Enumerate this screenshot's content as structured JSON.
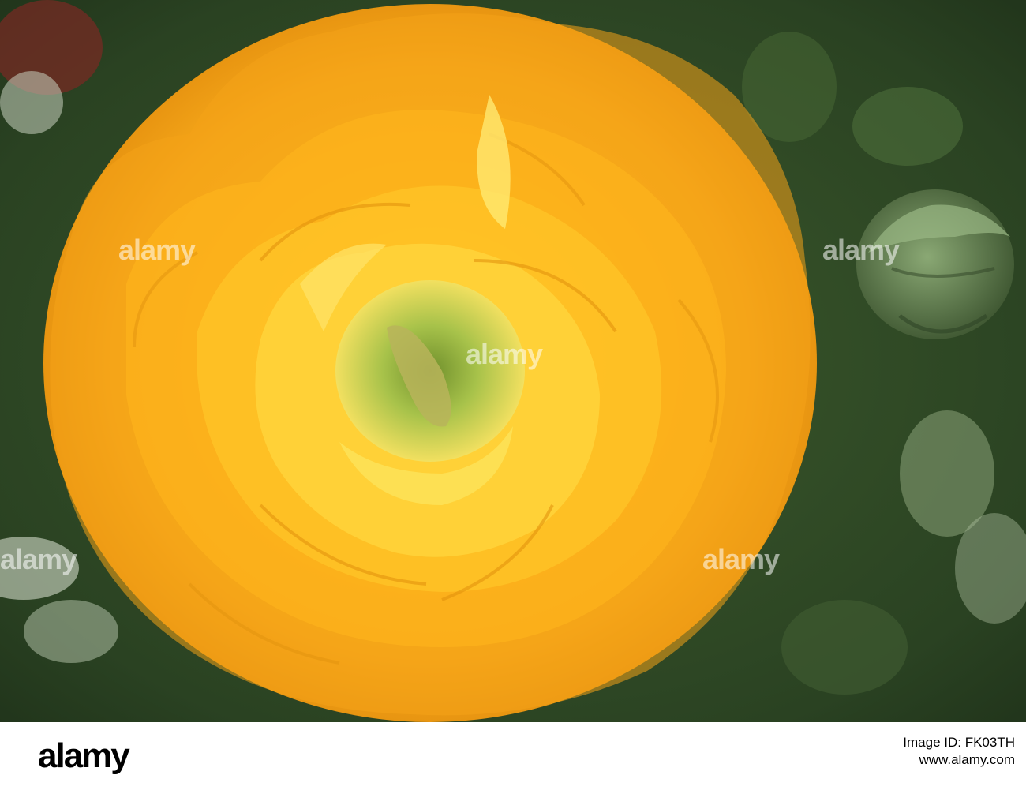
{
  "photo": {
    "subject": "",
    "colors": {
      "petal_main": "#f6a81a",
      "petal_light": "#ffd23a",
      "petal_shadow": "#d97f08",
      "center": "#8aa83a",
      "background": "#2d4424",
      "bud": "#5d7a4a"
    }
  },
  "watermark": {
    "text": "alamy"
  },
  "footer": {
    "brand": "alamy",
    "image_id": "Image ID: FK03TH",
    "url": "www.alamy.com"
  }
}
